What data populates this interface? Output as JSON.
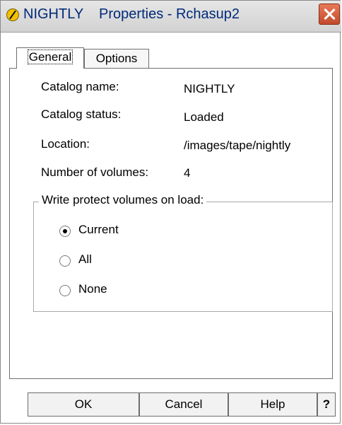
{
  "window": {
    "title": "NIGHTLY    Properties - Rchasup2"
  },
  "tabs": [
    {
      "label": "General",
      "active": true
    },
    {
      "label": "Options",
      "active": false
    }
  ],
  "general": {
    "fields": [
      {
        "label": "Catalog name:",
        "value": "NIGHTLY"
      },
      {
        "label": "Catalog status:",
        "value": "Loaded"
      },
      {
        "label": "Location:",
        "value": "/images/tape/nightly"
      },
      {
        "label": "Number of volumes:",
        "value": "4"
      }
    ],
    "write_protect": {
      "title": "Write protect volumes on load:",
      "options": [
        {
          "label": "Current",
          "checked": true
        },
        {
          "label": "All",
          "checked": false
        },
        {
          "label": "None",
          "checked": false
        }
      ]
    }
  },
  "buttons": {
    "ok": "OK",
    "cancel": "Cancel",
    "help": "Help",
    "question": "?"
  },
  "colors": {
    "title_text": "#002a7a",
    "close_button": "#c24a2c",
    "icon": "#f2c200"
  },
  "icons": {
    "title": "catalog-icon",
    "close": "close-icon"
  }
}
